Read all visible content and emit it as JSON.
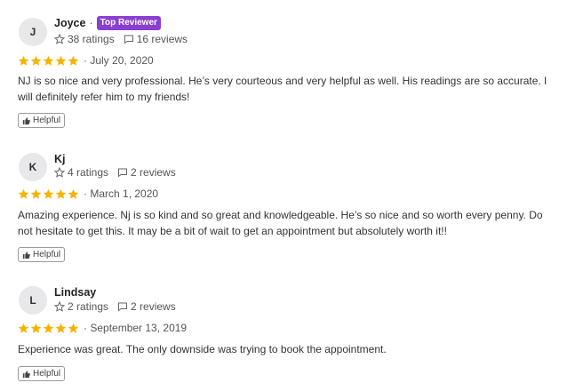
{
  "reviews": [
    {
      "initial": "J",
      "name": "Joyce",
      "badge": "Top Reviewer",
      "ratings": "38 ratings",
      "reviews_count": "16 reviews",
      "stars": 5,
      "date": "July 20, 2020",
      "text": "NJ is so nice and very professional. He’s very courteous and very helpful as well. His readings are so accurate. I will definitely refer him to my friends!",
      "helpful_label": "Helpful"
    },
    {
      "initial": "K",
      "name": "Kj",
      "ratings": "4 ratings",
      "reviews_count": "2 reviews",
      "stars": 5,
      "date": "March 1, 2020",
      "text": "Amazing experience. Nj is so kind and so great and knowledgeable. He’s so nice and so worth every penny. Do not hesitate to get this. It may be a bit of wait to get an appointment but absolutely worth it!!",
      "helpful_label": "Helpful"
    },
    {
      "initial": "L",
      "name": "Lindsay",
      "ratings": "2 ratings",
      "reviews_count": "2 reviews",
      "stars": 5,
      "date": "September 13, 2019",
      "text": "Experience was great. The only downside was trying to book the appointment.",
      "helpful_label": "Helpful"
    }
  ],
  "colors": {
    "star": "#f5b301",
    "badge": "#8a3fd1"
  },
  "icons": {
    "rating": "star-outline-icon",
    "reviews": "comment-icon",
    "helpful": "thumbs-up-icon"
  }
}
